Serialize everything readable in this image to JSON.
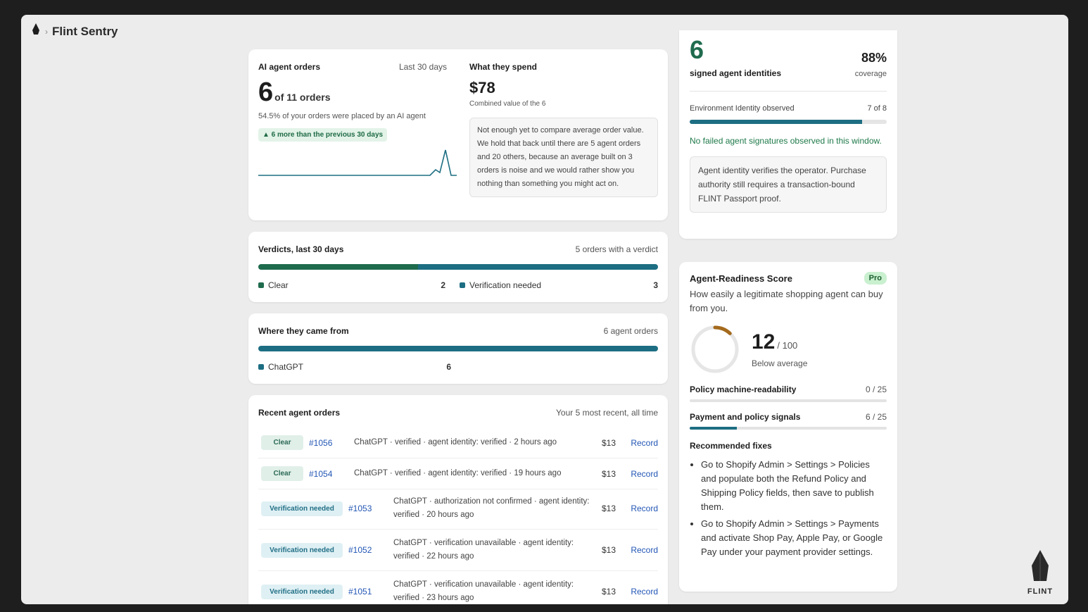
{
  "app": {
    "title": "Flint Sentry",
    "brand_logo_text": "FLINT"
  },
  "orders_card": {
    "title": "AI agent orders",
    "period": "Last 30 days",
    "count": "6",
    "of_total": "of 11 orders",
    "share_text": "54.5% of your orders were placed by an AI agent",
    "delta": "▲ 6 more than the previous 30 days",
    "spend_title": "What they spend",
    "spend_value": "$78",
    "spend_caption": "Combined value of the 6",
    "spend_note": "Not enough yet to compare average order value. We hold that back until there are 5 agent orders and 20 others, because an average built on 3 orders is noise and we would rather show you nothing than something you might act on."
  },
  "verdicts": {
    "title": "Verdicts, last 30 days",
    "summary": "5 orders with a verdict",
    "items": [
      {
        "label": "Clear",
        "value": "2",
        "count": 2,
        "color": "#1f6b4e"
      },
      {
        "label": "Verification needed",
        "value": "3",
        "count": 3,
        "color": "#1d6e82"
      }
    ]
  },
  "sources": {
    "title": "Where they came from",
    "summary": "6 agent orders",
    "items": [
      {
        "label": "ChatGPT",
        "value": "6",
        "count": 6,
        "color": "#1d6e82"
      }
    ]
  },
  "recent": {
    "title": "Recent agent orders",
    "summary": "Your 5 most recent, all time",
    "rows": [
      {
        "badge": "Clear",
        "kind": "clear",
        "id": "#1056",
        "desc": "ChatGPT · verified · agent identity: verified · 2 hours ago",
        "amount": "$13",
        "link": "Record"
      },
      {
        "badge": "Clear",
        "kind": "clear",
        "id": "#1054",
        "desc": "ChatGPT · verified · agent identity: verified · 19 hours ago",
        "amount": "$13",
        "link": "Record"
      },
      {
        "badge": "Verification needed",
        "kind": "ver",
        "id": "#1053",
        "desc": "ChatGPT · authorization not confirmed · agent identity: verified · 20 hours ago",
        "amount": "$13",
        "link": "Record"
      },
      {
        "badge": "Verification needed",
        "kind": "ver",
        "id": "#1052",
        "desc": "ChatGPT · verification unavailable · agent identity: verified · 22 hours ago",
        "amount": "$13",
        "link": "Record"
      },
      {
        "badge": "Verification needed",
        "kind": "ver",
        "id": "#1051",
        "desc": "ChatGPT · verification unavailable · agent identity: verified · 23 hours ago",
        "amount": "$13",
        "link": "Record"
      }
    ]
  },
  "identity": {
    "count": "6",
    "label": "signed agent identities",
    "coverage_value": "88%",
    "coverage_label": "coverage",
    "env_label": "Environment Identity observed",
    "env_value": "7 of 8",
    "env_fraction": 0.875,
    "status": "No failed agent signatures observed in this window.",
    "note": "Agent identity verifies the operator. Purchase authority still requires a transaction-bound FLINT Passport proof."
  },
  "readiness": {
    "title": "Agent-Readiness Score",
    "badge": "Pro",
    "subtitle": "How easily a legitimate shopping agent can buy from you.",
    "score": "12",
    "out_of": "/ 100",
    "score_fraction": 0.12,
    "rating": "Below average",
    "metrics": [
      {
        "label": "Policy machine-readability",
        "value": "0 / 25",
        "fraction": 0
      },
      {
        "label": "Payment and policy signals",
        "value": "6 / 25",
        "fraction": 0.24
      }
    ],
    "fixes_title": "Recommended fixes",
    "fixes": [
      "Go to Shopify Admin > Settings > Policies and populate both the Refund Policy and Shipping Policy fields, then save to publish them.",
      "Go to Shopify Admin > Settings > Payments and activate Shop Pay, Apple Pay, or Google Pay under your payment provider settings."
    ]
  },
  "colors": {
    "teal": "#1d6e82",
    "green": "#1f6b4e",
    "link": "#2256b5",
    "score_arc": "#a46a1c"
  }
}
